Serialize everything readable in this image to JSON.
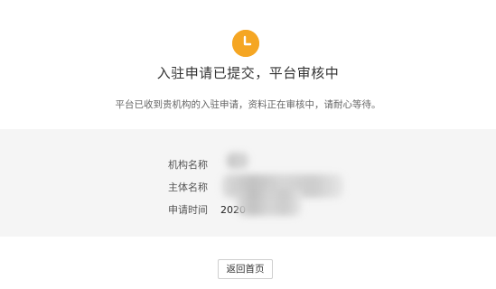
{
  "status": {
    "icon": "clock-icon",
    "icon_color": "#f5a623",
    "title": "入驻申请已提交，平台审核中",
    "message": "平台已收到贵机构的入驻申请，资料正在审核中，请耐心等待。"
  },
  "info": {
    "rows": [
      {
        "label": "机构名称",
        "value": ""
      },
      {
        "label": "主体名称",
        "value": ""
      },
      {
        "label": "申请时间",
        "value": "2020"
      }
    ]
  },
  "actions": {
    "back_label": "返回首页"
  }
}
